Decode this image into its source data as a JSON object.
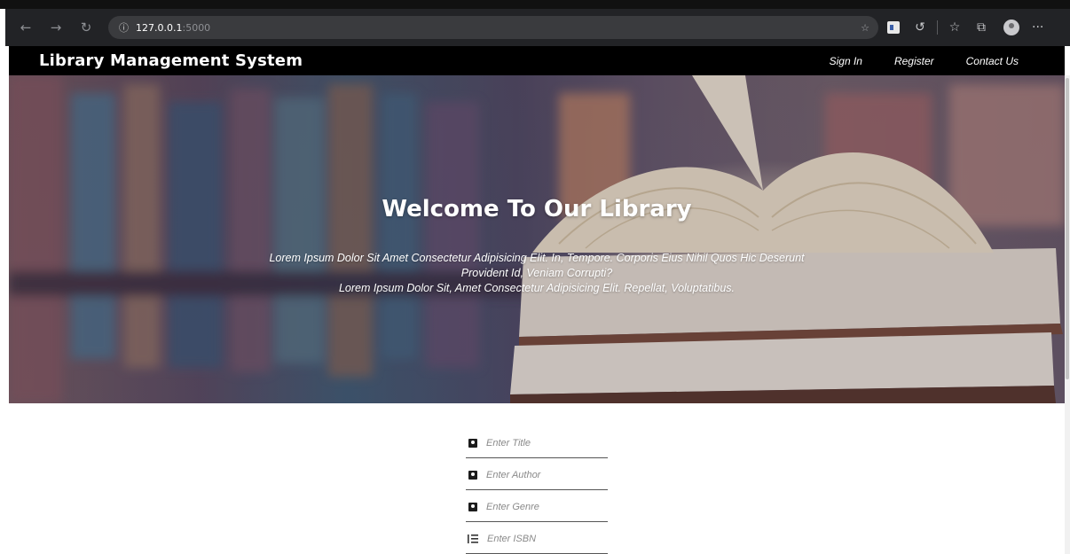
{
  "browser": {
    "url_host": "127.0.0.1",
    "url_port": ":5000"
  },
  "nav": {
    "brand": "Library Management System",
    "links": [
      "Sign In",
      "Register",
      "Contact Us"
    ]
  },
  "hero": {
    "title": "Welcome To Our Library",
    "line1": "Lorem Ipsum Dolor Sit Amet Consectetur Adipisicing Elit. In, Tempore. Corporis Eius Nihil Quos Hic Deserunt",
    "line2": "Provident Id, Veniam Corrupti?",
    "line3": "Lorem Ipsum Dolor Sit, Amet Consectetur Adipisicing Elit. Repellat, Voluptatibus."
  },
  "form": {
    "title_placeholder": "Enter Title",
    "author_placeholder": "Enter Author",
    "genre_placeholder": "Enter Genre",
    "isbn_placeholder": "Enter ISBN"
  },
  "icons": {
    "back": "arrow-left-icon",
    "forward": "arrow-right-icon",
    "reload": "reload-icon",
    "info": "info-icon",
    "favorites": "favorites-icon",
    "profile": "profile-icon",
    "more": "more-icon",
    "field_person": "person-icon",
    "field_list": "list-icon"
  },
  "colors": {
    "nav_bg": "#000000",
    "browser_bg": "#222326",
    "text_white": "#ffffff"
  }
}
